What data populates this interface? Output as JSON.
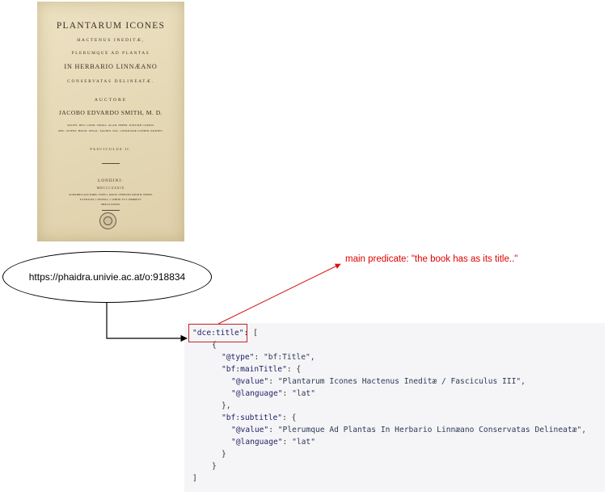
{
  "book": {
    "title": "PLANTARUM ICONES",
    "line2": "HACTENUS INEDITÆ,",
    "line3": "PLERUMQUE AD PLANTAS",
    "line4": "IN HERBARIO LINNÆANO",
    "line5": "CONSERVATAS DELINEATÆ.",
    "auctore": "AUCTORE",
    "author": "JACOBO EDVARDO SMITH, M. D.",
    "soc1": "SOCIET. REG. LOND. SODAL. ACAD. IMPER. NATURÆ CURIOS.",
    "soc2": "REG. SCIENT. HOLM. UPSAL. TAURIN. SOC. LINNÆANÆ LONDIN. PRÆSES.",
    "fasciculus": "FASCICULUS II.",
    "place": "LONDINI:",
    "year": "MDCCLXXXIX",
    "imprint1": "SUMTIBUS AUCTORIS. TYPIS J. DAVIS. VENEUNT APUD B. WHITE.",
    "imprint2": "ET FILIUM. J. SEWELL. J. WHITE. ET J. DEBRETT.",
    "imprint3": "MDCCLXXXIX."
  },
  "uri": "https://phaidra.univie.ac.at/o:918834",
  "annotation": "main predicate: \"the book has as its title..\"",
  "code": {
    "l1_key": "\"dce:title\"",
    "l1_rest": ": [",
    "l2": "{",
    "l3_key": "\"@type\"",
    "l3_val": "\"bf:Title\",",
    "l4_key": "\"bf:mainTitle\"",
    "l4_rest": ": {",
    "l5_key": "\"@value\"",
    "l5_val": "\"Plantarum Icones Hactenus Ineditæ / Fasciculus III\",",
    "l6_key": "\"@language\"",
    "l6_val": "\"lat\"",
    "l7": "},",
    "l8_key": "\"bf:subtitle\"",
    "l8_rest": ": {",
    "l9_key": "\"@value\"",
    "l9_val": "\"Plerumque Ad Plantas In Herbario Linnæano Conservatas Delineatæ\",",
    "l10_key": "\"@language\"",
    "l10_val": "\"lat\"",
    "l11": "}",
    "l12": "}",
    "l13": "]"
  },
  "colors": {
    "annotation": "#e00000",
    "highlight_box": "#c1272d",
    "code_bg": "#f5f5f7"
  }
}
